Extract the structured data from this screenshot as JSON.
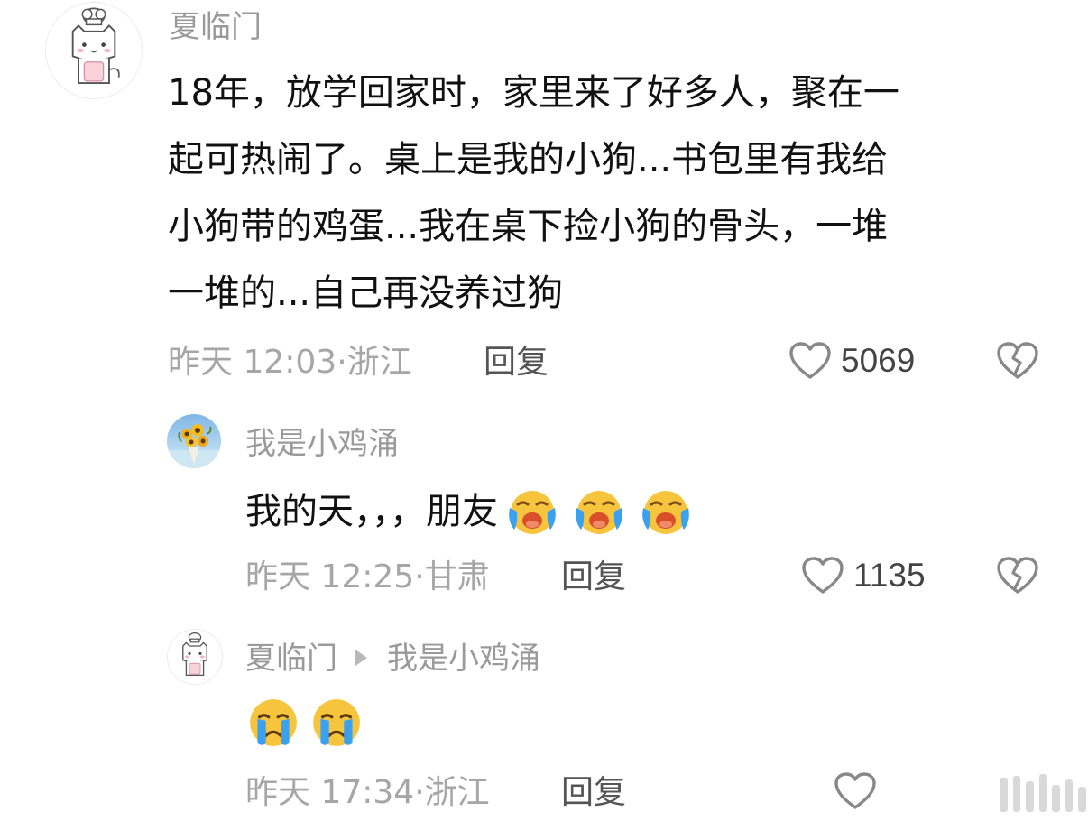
{
  "comments": [
    {
      "username": "夏临门",
      "text_lines": [
        "18年，放学回家时，家里来了好多人，聚在一",
        "起可热闹了。桌上是我的小狗...书包里有我给",
        "小狗带的鸡蛋...我在桌下捡小狗的骨头，一堆",
        "一堆的...自己再没养过狗"
      ],
      "time": "昨天 12:03",
      "location": "浙江",
      "reply_label": "回复",
      "likes": "5069",
      "avatar_icon": "cartoon-cat-chef-avatar"
    },
    {
      "username": "我是小鸡涌",
      "text": "我的天，，，朋友",
      "emoji_icons": [
        "loudly-crying-face-icon",
        "loudly-crying-face-icon",
        "loudly-crying-face-icon"
      ],
      "time": "昨天 12:25",
      "location": "甘肃",
      "reply_label": "回复",
      "likes": "1135",
      "avatar_icon": "sunflower-bouquet-avatar"
    },
    {
      "username": "夏临门",
      "reply_to": "我是小鸡涌",
      "emoji_icons": [
        "crying-face-icon",
        "crying-face-icon"
      ],
      "time": "昨天 17:34",
      "location": "浙江",
      "reply_label": "回复",
      "likes": "",
      "avatar_icon": "cartoon-cat-chef-avatar"
    }
  ],
  "meta_separator": "·",
  "colors": {
    "username": "#9a9a9a",
    "text": "#111111",
    "meta": "#a6a6a6",
    "reply": "#555555",
    "icon": "#888888",
    "emoji_yellow": "#f7c53d",
    "emoji_tear": "#3aa0f0",
    "emoji_mouth": "#d94f2a"
  }
}
